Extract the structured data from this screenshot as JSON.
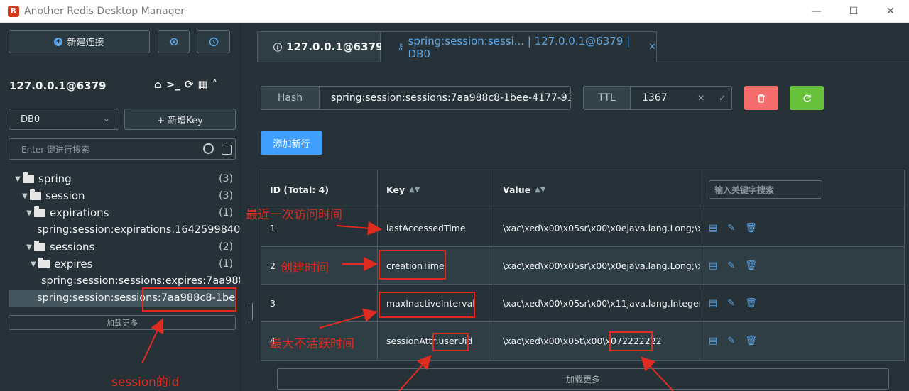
{
  "window": {
    "title": "Another Redis Desktop Manager",
    "app_icon": "R",
    "controls": [
      "—",
      "☐",
      "✕"
    ]
  },
  "sidebar": {
    "new_connection_label": "新建连接",
    "connection_name": "127.0.0.1@6379",
    "db_select": "DB0",
    "add_key_label": "+ 新增Key",
    "search_placeholder": "Enter 键进行搜索",
    "load_more_label": "加载更多",
    "tree": [
      {
        "label": "spring",
        "count": "(3)"
      },
      {
        "label": "session",
        "count": "(3)"
      },
      {
        "label": "expirations",
        "count": "(1)"
      },
      {
        "label": "spring:session:expirations:16425998400..."
      },
      {
        "label": "sessions",
        "count": "(2)"
      },
      {
        "label": "expires",
        "count": "(1)"
      },
      {
        "label": "spring:session:sessions:expires:7aa988c..."
      },
      {
        "label": "spring:session:sessions:7aa988c8-1bee-..."
      }
    ]
  },
  "tabs": [
    {
      "label": "127.0.0.1@6379"
    },
    {
      "label": "spring:session:sessi... | 127.0.0.1@6379 | DB0"
    }
  ],
  "key_bar": {
    "type_label": "Hash",
    "key_name": "spring:session:sessions:7aa988c8-1bee-4177-91a",
    "ttl_label": "TTL",
    "ttl_value": "1367"
  },
  "add_row_label": "添加新行",
  "table": {
    "headers": {
      "id": "ID (Total: 4)",
      "key": "Key",
      "value": "Value"
    },
    "keyword_placeholder": "输入关键字搜索",
    "rows": [
      {
        "id": "1",
        "key": "lastAccessedTime",
        "value": "\\xac\\xed\\x00\\x05sr\\x00\\x0ejava.lang.Long;\\x..."
      },
      {
        "id": "2",
        "key": "creationTime",
        "value": "\\xac\\xed\\x00\\x05sr\\x00\\x0ejava.lang.Long;\\x..."
      },
      {
        "id": "3",
        "key": "maxInactiveInterval",
        "value": "\\xac\\xed\\x00\\x05sr\\x00\\x11java.lang.Integer..."
      },
      {
        "id": "4",
        "key": "sessionAttr:userUid",
        "value": "\\xac\\xed\\x00\\x05t\\x00\\x072222222"
      }
    ],
    "load_more_label": "加载更多"
  },
  "annotations": {
    "last_access": "最近一次访问时间",
    "creation": "创建时间",
    "max_inactive": "最大不活跃时间",
    "session_id": "session的id"
  },
  "colors": {
    "accent": "#409eff",
    "danger": "#f56c6c",
    "success": "#67c23a",
    "annotation": "#e02b20",
    "background": "#263238"
  }
}
